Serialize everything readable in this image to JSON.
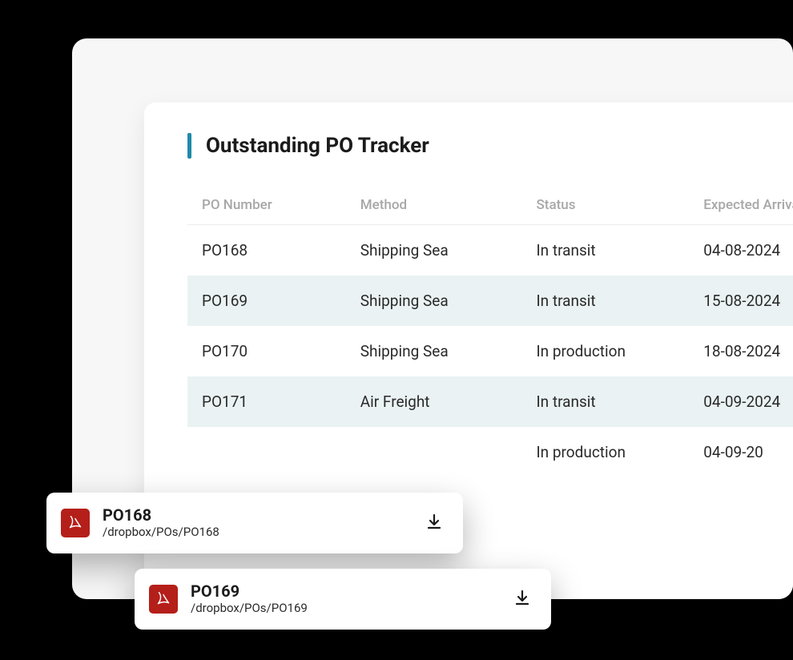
{
  "card": {
    "title": "Outstanding PO Tracker",
    "columns": {
      "po": "PO Number",
      "method": "Method",
      "status": "Status",
      "expected": "Expected Arrival"
    },
    "rows": [
      {
        "po": "PO168",
        "method": "Shipping Sea",
        "status": "In transit",
        "expected": "04-08-2024"
      },
      {
        "po": "PO169",
        "method": "Shipping Sea",
        "status": "In transit",
        "expected": "15-08-2024"
      },
      {
        "po": "PO170",
        "method": "Shipping Sea",
        "status": "In production",
        "expected": "18-08-2024"
      },
      {
        "po": "PO171",
        "method": "Air Freight",
        "status": "In transit",
        "expected": "04-09-2024"
      },
      {
        "po": "",
        "method": "",
        "status": "In production",
        "expected": "04-09-20"
      }
    ]
  },
  "files": [
    {
      "name": "PO168",
      "path": "/dropbox/POs/PO168"
    },
    {
      "name": "PO169",
      "path": "/dropbox/POs/PO169"
    }
  ]
}
